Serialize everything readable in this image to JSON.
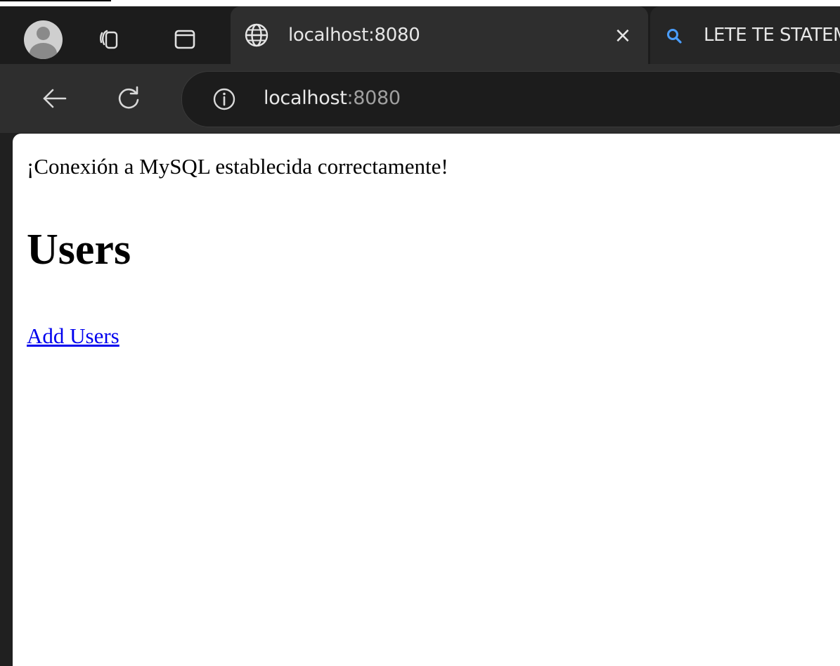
{
  "browser": {
    "tabs": [
      {
        "title": "localhost:8080",
        "active": true,
        "icon": "globe-icon"
      },
      {
        "title": "LETE TE STATEM",
        "active": false,
        "icon": "search-icon"
      }
    ],
    "address": {
      "host": "localhost",
      "port": ":8080"
    },
    "colors": {
      "tabstrip": "#1c1c1c",
      "active_tab": "#2e2e2e",
      "search_icon": "#4a9eff"
    }
  },
  "page": {
    "status_message": "¡Conexión a MySQL establecida correctamente!",
    "heading": "Users",
    "add_users_link": "Add Users",
    "link_color": "#0000ee"
  }
}
